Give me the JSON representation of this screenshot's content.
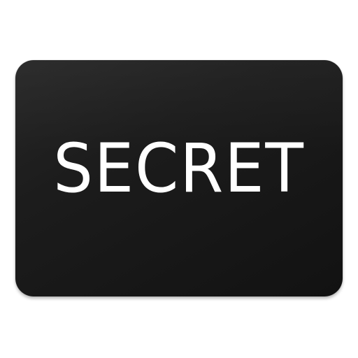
{
  "icon": {
    "text": "SECRET",
    "card_color": "#1a1a1a",
    "text_color": "#ffffff",
    "background_color": "#ffffff"
  }
}
